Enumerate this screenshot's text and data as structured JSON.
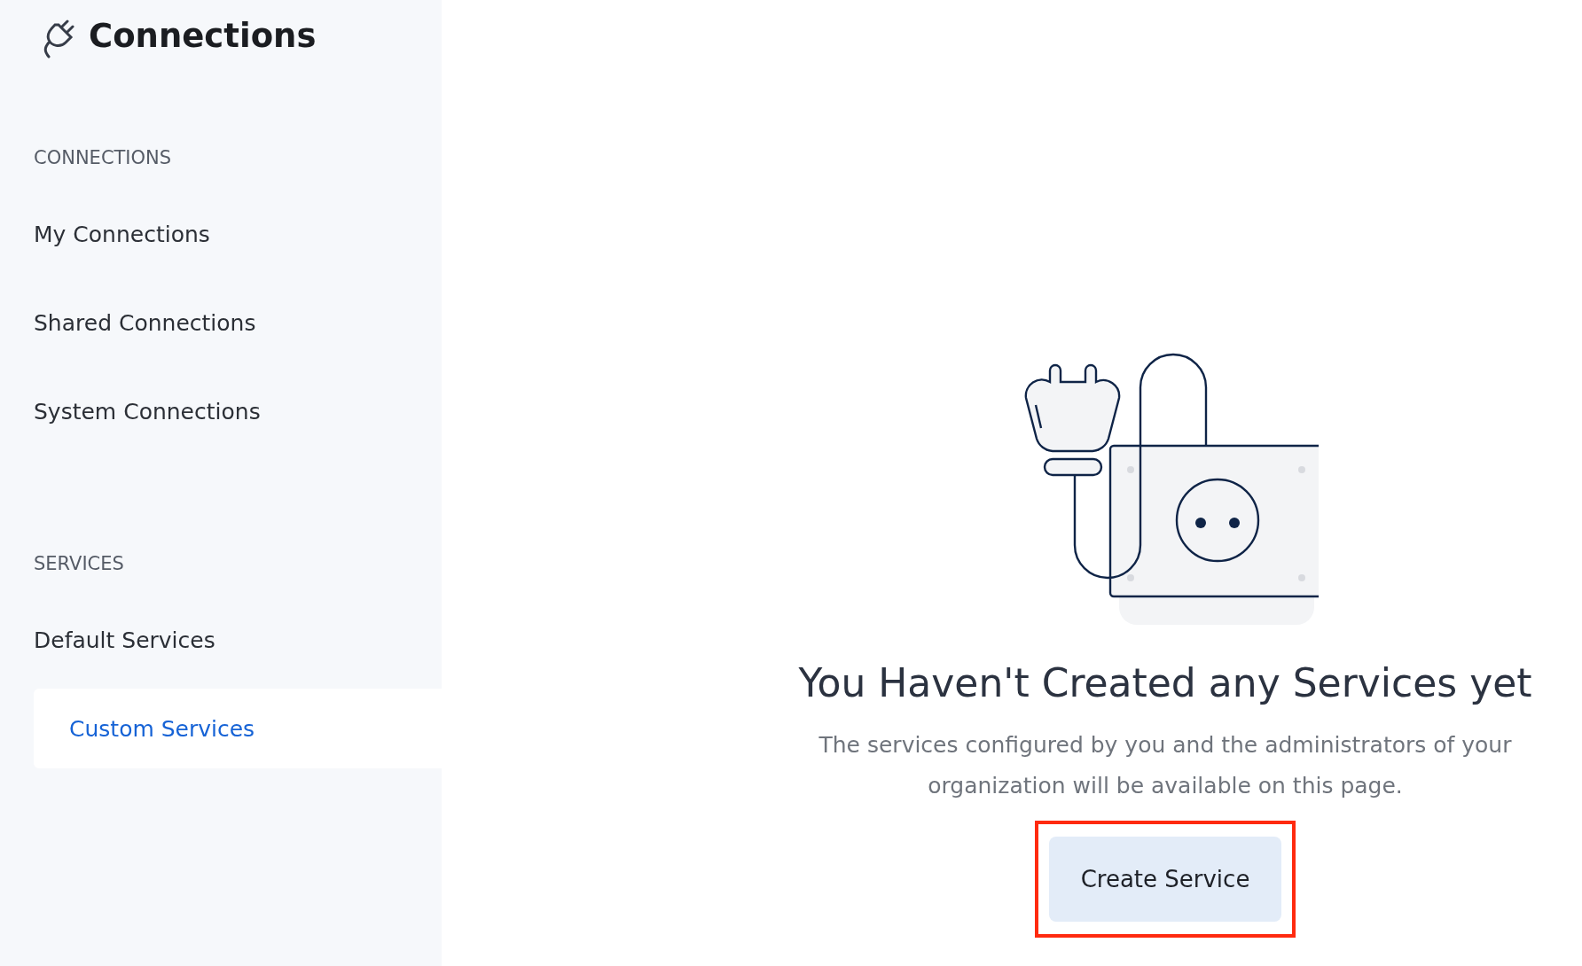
{
  "sidebar": {
    "title": "Connections",
    "sections": [
      {
        "heading": "CONNECTIONS",
        "items": [
          {
            "label": "My Connections",
            "selected": false
          },
          {
            "label": "Shared Connections",
            "selected": false
          },
          {
            "label": "System Connections",
            "selected": false
          }
        ]
      },
      {
        "heading": "SERVICES",
        "items": [
          {
            "label": "Default Services",
            "selected": false
          },
          {
            "label": "Custom Services",
            "selected": true
          }
        ]
      }
    ]
  },
  "empty_state": {
    "heading": "You Haven't Created any Services yet",
    "message": "The services configured by you and the administrators of your organization will be available on this page.",
    "button": {
      "label": "Create Service",
      "highlighted": true
    }
  }
}
